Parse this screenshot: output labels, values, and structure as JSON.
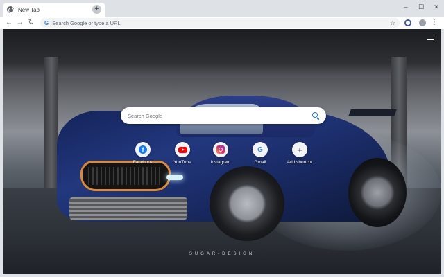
{
  "browser": {
    "tab_title": "New Tab",
    "tab_close": "×",
    "new_tab": "+",
    "window_controls": [
      "–",
      "☐",
      "✕"
    ],
    "nav": {
      "back": "←",
      "forward": "→",
      "reload": "↻"
    },
    "omnibox_placeholder": "Search Google or type a URL",
    "omnibox_g": "G",
    "star": "☆",
    "menu": "⋮"
  },
  "newtab": {
    "search_placeholder": "Search Google",
    "watermark": "SUGAR-DESIGN",
    "shortcuts": [
      {
        "label": "Facebook",
        "icon": "facebook-icon",
        "glyph": "f"
      },
      {
        "label": "YouTube",
        "icon": "youtube-icon"
      },
      {
        "label": "Instagram",
        "icon": "instagram-icon"
      },
      {
        "label": "Gmail",
        "icon": "gmail-icon",
        "glyph": "G"
      },
      {
        "label": "Add shortcut",
        "icon": "add-icon",
        "glyph": "+"
      }
    ]
  }
}
